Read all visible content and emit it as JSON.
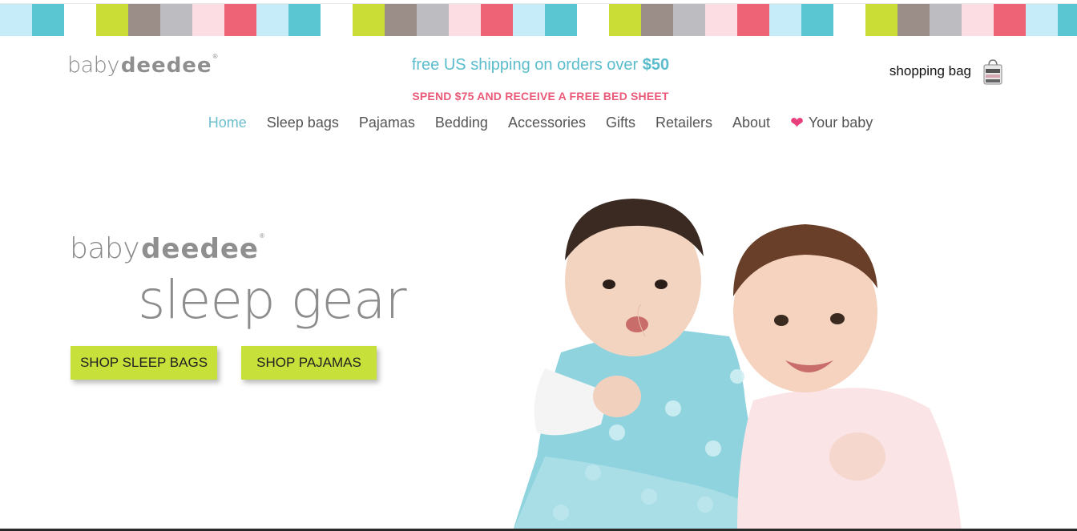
{
  "stripe_colors": [
    "#c6ecfa",
    "#59c6d2",
    "#ffffff",
    "#cadd36",
    "#9b8d88",
    "#bdbdc1",
    "#fcdde4",
    "#ef6377",
    "#c6ecfa",
    "#59c6d2",
    "#ffffff",
    "#cadd36",
    "#9b8d88",
    "#bdbdc1",
    "#fcdde4",
    "#ef6377",
    "#c6ecfa",
    "#59c6d2",
    "#ffffff",
    "#cadd36",
    "#9b8d88",
    "#bdbdc1",
    "#fcdde4",
    "#ef6377",
    "#c6ecfa",
    "#59c6d2",
    "#ffffff",
    "#cadd36",
    "#9b8d88",
    "#bdbdc1",
    "#fcdde4",
    "#ef6377",
    "#c6ecfa",
    "#59c6d2"
  ],
  "brand": {
    "prefix": "baby",
    "mark": "deedee",
    "registered": "®"
  },
  "header": {
    "shipping_text": "free US shipping on orders over ",
    "shipping_amount": "$50",
    "promo_text": "SPEND $75 AND RECEIVE A FREE BED SHEET",
    "bag_label": "shopping bag",
    "bag_icon": "shopping-bag-icon"
  },
  "nav": {
    "items": [
      {
        "label": "Home",
        "active": true
      },
      {
        "label": "Sleep bags"
      },
      {
        "label": "Pajamas"
      },
      {
        "label": "Bedding"
      },
      {
        "label": "Accessories"
      },
      {
        "label": "Gifts"
      },
      {
        "label": "Retailers"
      },
      {
        "label": "About"
      },
      {
        "label": "Your baby",
        "icon": "heart-icon"
      }
    ]
  },
  "hero": {
    "title": "sleep gear",
    "buttons": {
      "sleep_bags": "SHOP SLEEP BAGS",
      "pajamas": "SHOP PAJAMAS"
    }
  },
  "colors": {
    "accent_teal": "#5bbccc",
    "promo_pink": "#ea5a78",
    "button_green": "#c8e03a",
    "heart_pink": "#e83e7b"
  }
}
